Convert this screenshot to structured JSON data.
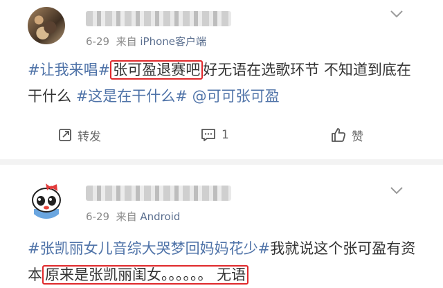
{
  "posts": [
    {
      "date": "6-29",
      "source_prefix": "来自",
      "source": "iPhone客户端",
      "content": {
        "tag1": "#让我来唱#",
        "boxed": "张可盈退赛吧",
        "text1": "好无语在选歌环节 不知道到底在干什么 ",
        "tag2": "#这是在干什么#",
        "mention": " @可可张可盈"
      },
      "actions": {
        "repost": "转发",
        "comment": "1",
        "like": "赞"
      }
    },
    {
      "date": "6-29",
      "source_prefix": "来自",
      "source": "Android",
      "content": {
        "tag1": "#张凯丽女儿音综大哭梦回妈妈花少#",
        "text1": "我就说这个张可盈有资本",
        "boxed": "原来是张凯丽闺女。。。。。。 无语"
      }
    }
  ],
  "colors": {
    "link": "#4f73a8",
    "highlight_box": "#e0282b",
    "meta": "#8a8a8a"
  }
}
